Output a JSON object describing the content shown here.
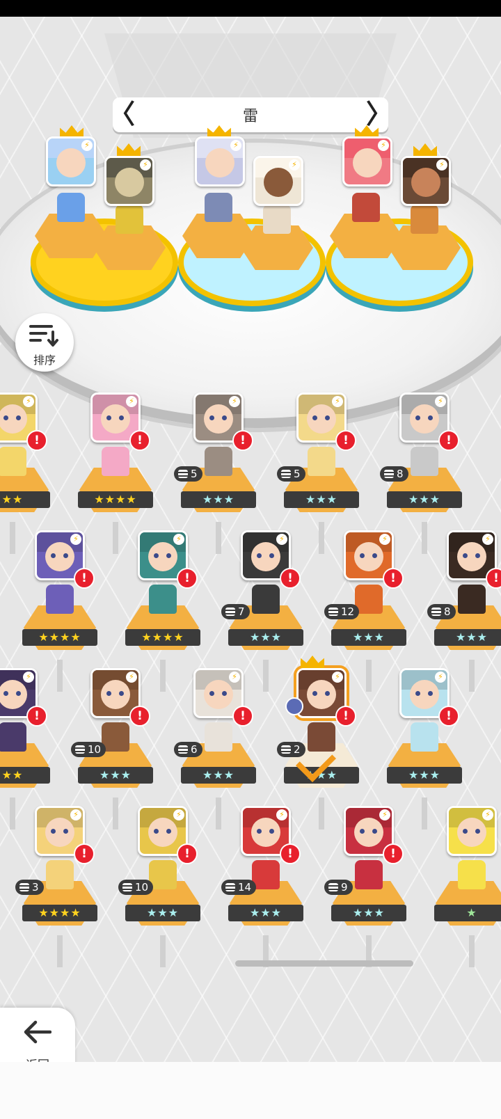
{
  "region": {
    "title": "雷",
    "prev_symbol": "〈",
    "next_symbol": "〉"
  },
  "sort": {
    "label": "排序"
  },
  "back": {
    "label": "返回"
  },
  "icons": {
    "bolt": "⚡",
    "alert": "!",
    "star": "★"
  },
  "colors": {
    "gold": "#ffd21f",
    "alert": "#e8202d",
    "pedestal": "#f3b042",
    "starbar": "#3b3b3b",
    "ring_aqua": "#bff2ff"
  },
  "team": [
    {
      "portraits": 2,
      "ring": "gold"
    },
    {
      "portraits": 2,
      "ring": "aqua"
    },
    {
      "portraits": 2,
      "ring": "aqua"
    }
  ],
  "roster": [
    {
      "stars": "★★",
      "star_color": "gold",
      "count": ""
    },
    {
      "stars": "★★★★",
      "star_color": "gold",
      "count": ""
    },
    {
      "stars": "★★★",
      "star_color": "silver",
      "count": "5"
    },
    {
      "stars": "★★★",
      "star_color": "silver",
      "count": "5"
    },
    {
      "stars": "★★★",
      "star_color": "silver",
      "count": "8"
    },
    {
      "stars": "★★★★",
      "star_color": "gold",
      "count": ""
    },
    {
      "stars": "★★★★",
      "star_color": "gold",
      "count": ""
    },
    {
      "stars": "★★★",
      "star_color": "silver",
      "count": "7"
    },
    {
      "stars": "★★★",
      "star_color": "silver",
      "count": "12"
    },
    {
      "stars": "★★★",
      "star_color": "silver",
      "count": "8"
    },
    {
      "stars": "★★",
      "star_color": "gold",
      "count": ""
    },
    {
      "stars": "★★★",
      "star_color": "silver",
      "count": "10"
    },
    {
      "stars": "★★★",
      "star_color": "silver",
      "count": "6"
    },
    {
      "stars": "★★★",
      "star_color": "silver",
      "count": "2"
    },
    {
      "stars": "★★★",
      "star_color": "silver",
      "count": ""
    },
    {
      "stars": "★★★★",
      "star_color": "gold",
      "count": "3"
    },
    {
      "stars": "★★★",
      "star_color": "silver",
      "count": "10"
    },
    {
      "stars": "★★★",
      "star_color": "silver",
      "count": "14"
    },
    {
      "stars": "★★★",
      "star_color": "silver",
      "count": "9"
    },
    {
      "stars": "★",
      "star_color": "green",
      "count": ""
    }
  ]
}
